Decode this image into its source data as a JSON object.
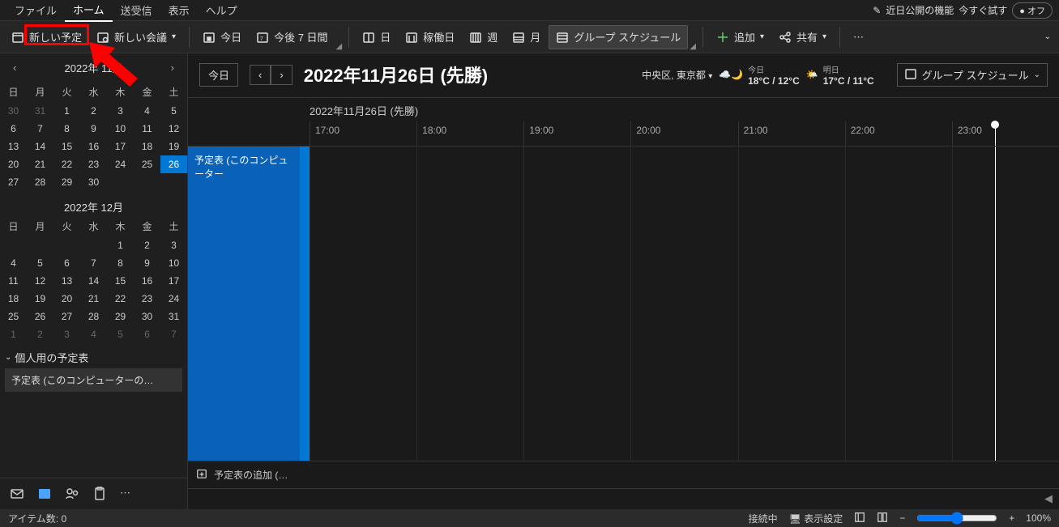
{
  "menu": {
    "file": "ファイル",
    "home": "ホーム",
    "sendrecv": "送受信",
    "view": "表示",
    "help": "ヘルプ",
    "coming": "近日公開の機能",
    "try": "今すぐ試す",
    "off": "オフ"
  },
  "toolbar": {
    "newAppt": "新しい予定",
    "newMeeting": "新しい会議",
    "today": "今日",
    "next7": "今後 7 日間",
    "day": "日",
    "workday": "稼働日",
    "week": "週",
    "month": "月",
    "group": "グループ スケジュール",
    "add": "追加",
    "share": "共有"
  },
  "sidebar": {
    "monthA": "2022年 11月",
    "monthB": "2022年 12月",
    "dow": [
      "日",
      "月",
      "火",
      "水",
      "木",
      "金",
      "土"
    ],
    "novRows": [
      [
        "30",
        "31",
        "1",
        "2",
        "3",
        "4",
        "5"
      ],
      [
        "6",
        "7",
        "8",
        "9",
        "10",
        "11",
        "12"
      ],
      [
        "13",
        "14",
        "15",
        "16",
        "17",
        "18",
        "19"
      ],
      [
        "20",
        "21",
        "22",
        "23",
        "24",
        "25",
        "26"
      ],
      [
        "27",
        "28",
        "29",
        "30",
        "",
        "",
        ""
      ]
    ],
    "decRows": [
      [
        "",
        "",
        "",
        "1",
        "2",
        "3"
      ],
      [
        "4",
        "5",
        "6",
        "7",
        "8",
        "9",
        "10"
      ],
      [
        "11",
        "12",
        "13",
        "14",
        "15",
        "16",
        "17"
      ],
      [
        "18",
        "19",
        "20",
        "21",
        "22",
        "23",
        "24"
      ],
      [
        "25",
        "26",
        "27",
        "28",
        "29",
        "30",
        "31"
      ],
      [
        "1",
        "2",
        "3",
        "4",
        "5",
        "6",
        "7"
      ]
    ],
    "personal": "個人用の予定表",
    "calItem": "予定表 (このコンピューターの…"
  },
  "content": {
    "todayBtn": "今日",
    "dateTitle": "2022年11月26日 (先勝)",
    "location": "中央区, 東京都",
    "w1": {
      "label": "今日",
      "temp": "18°C / 12°C"
    },
    "w2": {
      "label": "明日",
      "temp": "17°C / 11°C"
    },
    "gs": "グループ スケジュール",
    "timelineDate": "2022年11月26日 (先勝)",
    "hours": [
      "17:00",
      "18:00",
      "19:00",
      "20:00",
      "21:00",
      "22:00",
      "23:00"
    ],
    "rowLabel": "予定表 (このコンピューター",
    "addCal": "予定表の追加 (…"
  },
  "status": {
    "items": "アイテム数:  0",
    "conn": "接続中",
    "disp": "表示設定",
    "zoom": "100%"
  }
}
